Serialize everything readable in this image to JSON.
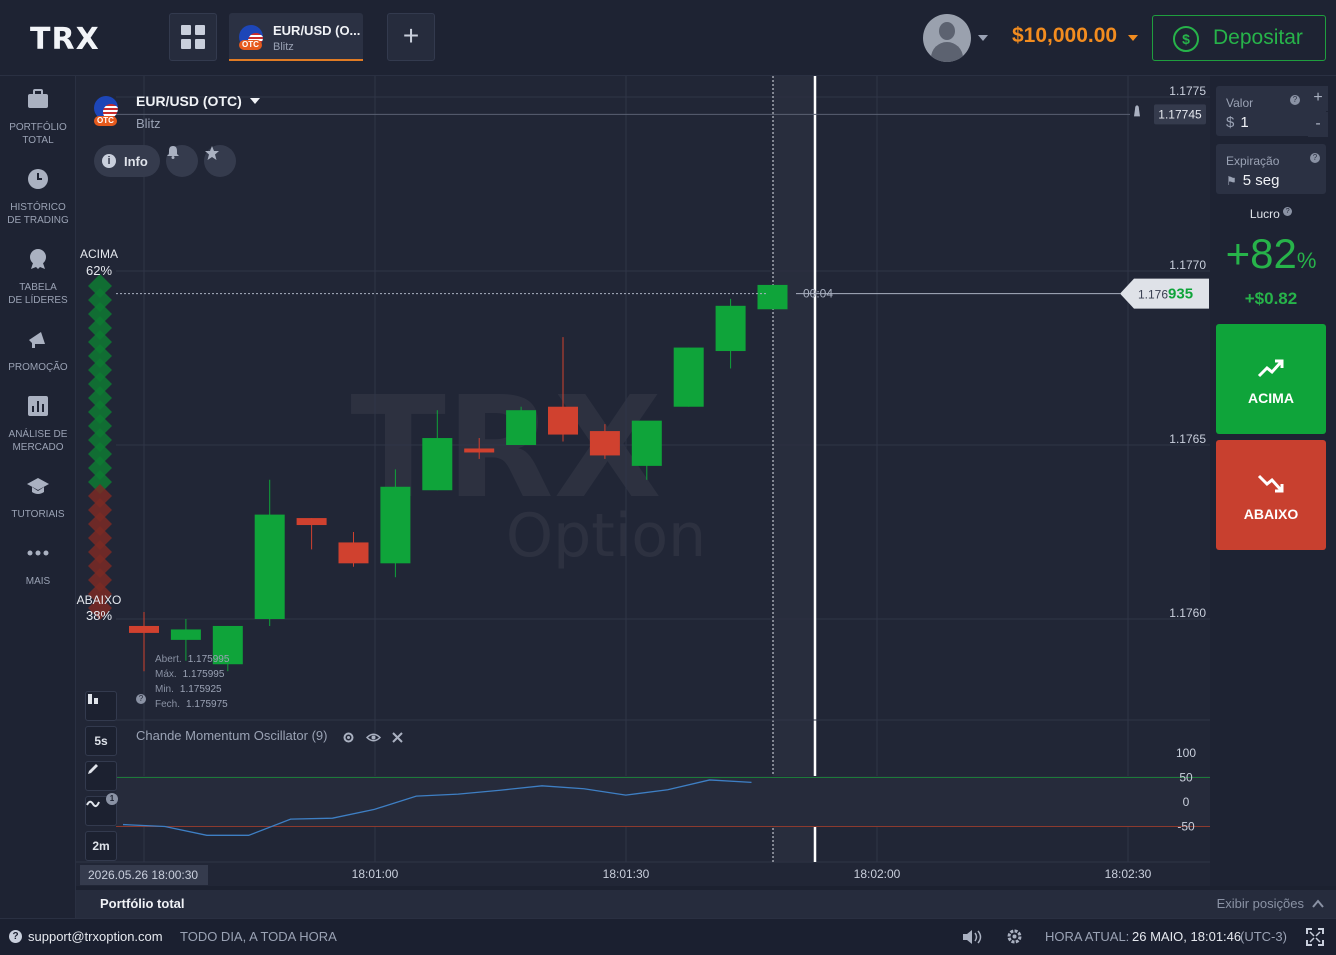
{
  "header": {
    "logo": "TRX",
    "asset_tab": {
      "name": "EUR/USD (O...",
      "mode": "Blitz",
      "badge": "OTC"
    },
    "add_tab": "+",
    "balance": "$10,000.00",
    "deposit_label": "Depositar"
  },
  "sidebar": {
    "items": [
      {
        "label_1": "PORTFÓLIO",
        "label_2": "TOTAL",
        "icon": "briefcase-icon"
      },
      {
        "label_1": "HISTÓRICO",
        "label_2": "DE TRADING",
        "icon": "clock-icon"
      },
      {
        "label_1": "TABELA",
        "label_2": "DE LÍDERES",
        "icon": "trophy-icon"
      },
      {
        "label_1": "PROMOÇÃO",
        "label_2": "",
        "icon": "megaphone-icon"
      },
      {
        "label_1": "ANÁLISE DE",
        "label_2": "MERCADO",
        "icon": "bar-chart-icon"
      },
      {
        "label_1": "TUTORIAIS",
        "label_2": "",
        "icon": "graduation-cap-icon"
      },
      {
        "label_1": "MAIS",
        "label_2": "",
        "icon": "more-dots-icon"
      }
    ]
  },
  "chart": {
    "asset_title": "EUR/USD (OTC)",
    "asset_mode": "Blitz",
    "badge": "OTC",
    "info_label": "Info",
    "sentiment": {
      "up_label": "ACIMA",
      "up_pct": "62%",
      "down_label": "ABAIXO",
      "down_pct": "38%",
      "up_fraction": 0.62
    },
    "price_ticks": [
      "1.1775",
      "1.1770",
      "1.1765",
      "1.1760"
    ],
    "alert_price": "1.17745",
    "current_price_prefix": "1.176",
    "current_price_suffix": "935",
    "countdown": "00:04",
    "time_ticks": [
      "18:01:00",
      "18:01:30",
      "18:02:00",
      "18:02:30"
    ],
    "current_time_label": "2026.05.26 18:00:30",
    "ohlc": {
      "open_label": "Abert.",
      "open": "1.175995",
      "high_label": "Máx.",
      "high": "1.175995",
      "low_label": "Min.",
      "low": "1.175925",
      "close_label": "Fech.",
      "close": "1.175975"
    },
    "tools": {
      "timeframe": "5s",
      "zoom": "2m",
      "indicator_count": "1"
    },
    "watermark_1": "TRX",
    "watermark_2": "Option",
    "indicator": {
      "name": "Chande Momentum Oscillator (9)",
      "levels": [
        "100",
        "50",
        "0",
        "-50"
      ]
    },
    "colors": {
      "up": "#0fa43a",
      "down": "#d0412f",
      "accent": "#f28c1f"
    }
  },
  "chart_data": {
    "type": "candlestick",
    "title": "EUR/USD (OTC)",
    "ylim": [
      1.1757,
      1.1776
    ],
    "candles": [
      {
        "o": 1.17598,
        "h": 1.17602,
        "l": 1.17585,
        "c": 1.17596,
        "dir": "down"
      },
      {
        "o": 1.17594,
        "h": 1.176,
        "l": 1.17588,
        "c": 1.17597,
        "dir": "up"
      },
      {
        "o": 1.17587,
        "h": 1.17598,
        "l": 1.17585,
        "c": 1.17598,
        "dir": "up"
      },
      {
        "o": 1.176,
        "h": 1.1764,
        "l": 1.17598,
        "c": 1.1763,
        "dir": "up"
      },
      {
        "o": 1.17629,
        "h": 1.17629,
        "l": 1.1762,
        "c": 1.17627,
        "dir": "down"
      },
      {
        "o": 1.17622,
        "h": 1.17625,
        "l": 1.17615,
        "c": 1.17616,
        "dir": "down"
      },
      {
        "o": 1.17616,
        "h": 1.17643,
        "l": 1.17612,
        "c": 1.17638,
        "dir": "up"
      },
      {
        "o": 1.17637,
        "h": 1.1766,
        "l": 1.17637,
        "c": 1.17652,
        "dir": "up"
      },
      {
        "o": 1.17649,
        "h": 1.17652,
        "l": 1.17646,
        "c": 1.17648,
        "dir": "down"
      },
      {
        "o": 1.1765,
        "h": 1.17661,
        "l": 1.1765,
        "c": 1.1766,
        "dir": "up"
      },
      {
        "o": 1.17661,
        "h": 1.17681,
        "l": 1.17651,
        "c": 1.17653,
        "dir": "down"
      },
      {
        "o": 1.17654,
        "h": 1.17656,
        "l": 1.17646,
        "c": 1.17647,
        "dir": "down"
      },
      {
        "o": 1.17644,
        "h": 1.17656,
        "l": 1.1764,
        "c": 1.17657,
        "dir": "up"
      },
      {
        "o": 1.17661,
        "h": 1.17678,
        "l": 1.17661,
        "c": 1.17678,
        "dir": "up"
      },
      {
        "o": 1.17677,
        "h": 1.17692,
        "l": 1.17672,
        "c": 1.1769,
        "dir": "up"
      },
      {
        "o": 1.17689,
        "h": 1.17696,
        "l": 1.17689,
        "c": 1.17696,
        "dir": "up"
      }
    ],
    "indicator_values": [
      -46,
      -50,
      -68,
      -68,
      -35,
      -33,
      -15,
      12,
      16,
      24,
      33,
      27,
      14,
      25,
      45,
      40
    ]
  },
  "right_panel": {
    "value_label": "Valor",
    "value_currency": "$",
    "value": "1",
    "expiry_label": "Expiração",
    "expiry": "5 seg",
    "profit_label": "Lucro",
    "profit_pct": "+82",
    "pct_sign": "%",
    "profit_amount": "+$0.82",
    "up_button": "ACIMA",
    "down_button": "ABAIXO"
  },
  "portfolio_bar": {
    "title": "Portfólio total",
    "show_positions": "Exibir posições"
  },
  "footer": {
    "support_email": "support@trxoption.com",
    "tagline": "TODO DIA, A TODA HORA",
    "time_label": "HORA ATUAL:",
    "time_value": "26 MAIO, 18:01:46",
    "timezone": "(UTC-3)"
  }
}
